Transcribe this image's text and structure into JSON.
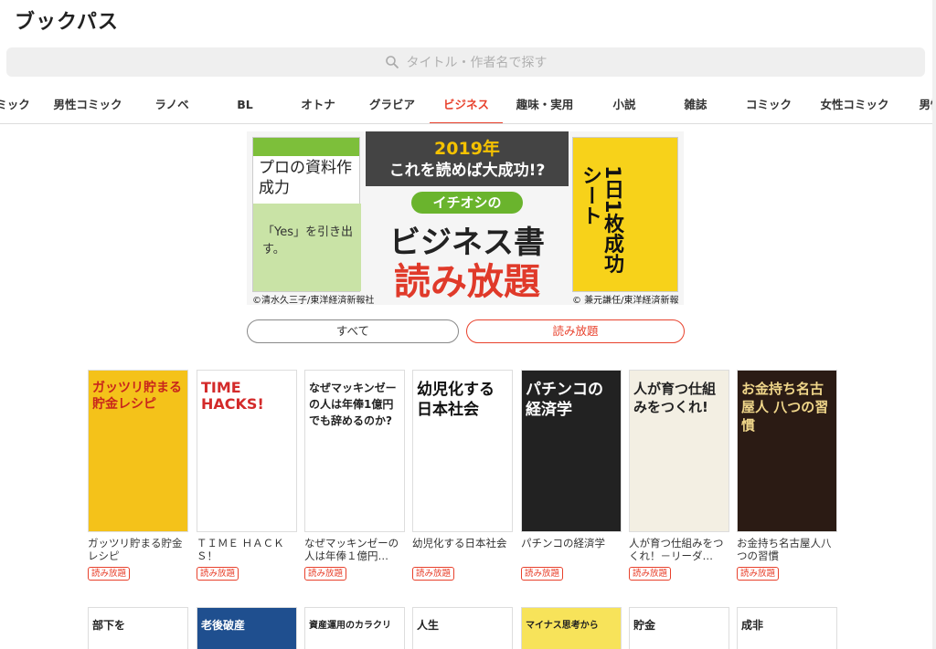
{
  "app": {
    "logo": "ブックパス"
  },
  "search": {
    "placeholder": "タイトル・作者名で探す"
  },
  "tabs": [
    {
      "label": "ミック"
    },
    {
      "label": "男性コミック"
    },
    {
      "label": "ラノベ"
    },
    {
      "label": "BL"
    },
    {
      "label": "オトナ"
    },
    {
      "label": "グラビア"
    },
    {
      "label": "ビジネス",
      "active": true
    },
    {
      "label": "趣味・実用"
    },
    {
      "label": "小説"
    },
    {
      "label": "雑誌"
    },
    {
      "label": "コミック"
    },
    {
      "label": "女性コミック"
    },
    {
      "label": "男性"
    }
  ],
  "banner": {
    "left_book_title": "プロの資料作成力",
    "left_book_sub": "「Yes」を引き出す。",
    "year": "2019年",
    "line2": "これを読めば大成功!?",
    "pill": "イチオシの",
    "biz": "ビジネス書",
    "yomi": "読み放題",
    "right_book_title": "1日1枚成功シート",
    "caption_left": "©清水久三子/東洋経済新報社",
    "caption_right": "© 兼元謙任/東洋経済新報社"
  },
  "filters": {
    "all": "すべて",
    "free": "読み放題"
  },
  "books": [
    {
      "cover_text": "ガッツリ貯まる貯金レシピ",
      "title": "ガッツリ貯まる貯金レシピ",
      "badge": "読み放題",
      "color": "#f4c21a"
    },
    {
      "cover_text": "TIME HACKS!",
      "title": "ＴＩＭＥ ＨＡＣＫＳ！",
      "badge": "読み放題",
      "color": "#ffffff"
    },
    {
      "cover_text": "なぜマッキンゼーの人は年俸1億円でも辞めるのか?",
      "title": "なぜマッキンゼーの人は年俸１億円…",
      "badge": "読み放題",
      "color": "#ffffff"
    },
    {
      "cover_text": "幼児化する日本社会",
      "title": "幼児化する日本社会",
      "badge": "読み放題",
      "color": "#ffffff"
    },
    {
      "cover_text": "パチンコの経済学",
      "title": "パチンコの経済学",
      "badge": "読み放題",
      "color": "#222222"
    },
    {
      "cover_text": "人が育つ仕組みをつくれ!",
      "title": "人が育つ仕組みをつくれ！－リーダ…",
      "badge": "読み放題",
      "color": "#f3efe3"
    },
    {
      "cover_text": "お金持ち名古屋人 八つの習慣",
      "title": "お金持ち名古屋人八つの習慣",
      "badge": "読み放題",
      "color": "#2b1b14"
    }
  ],
  "row2": [
    "部下を",
    "老後破産",
    "資産運用のカラクリ",
    "人生",
    "マイナス思考から",
    "貯金",
    "成非"
  ],
  "colors": {
    "accent": "#e8412c"
  }
}
